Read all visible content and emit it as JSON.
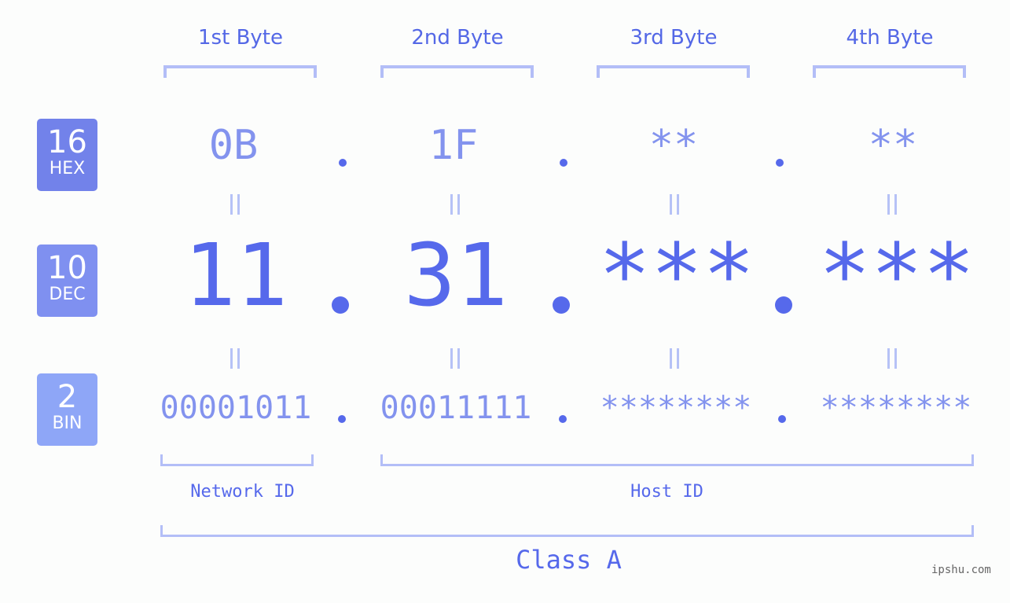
{
  "bytes": [
    {
      "header": "1st Byte",
      "hex": "0B",
      "dec": "11",
      "bin": "00001011"
    },
    {
      "header": "2nd Byte",
      "hex": "1F",
      "dec": "31",
      "bin": "00011111"
    },
    {
      "header": "3rd Byte",
      "hex": "**",
      "dec": "***",
      "bin": "********"
    },
    {
      "header": "4th Byte",
      "hex": "**",
      "dec": "***",
      "bin": "********"
    }
  ],
  "badges": {
    "hex": {
      "num": "16",
      "label": "HEX",
      "color": "#7282ea"
    },
    "dec": {
      "num": "10",
      "label": "DEC",
      "color": "#7f90f0"
    },
    "bin": {
      "num": "2",
      "label": "BIN",
      "color": "#8ea6f7"
    }
  },
  "separator": ".",
  "groups": {
    "network": "Network ID",
    "host": "Host ID",
    "class": "Class A"
  },
  "watermark": "ipshu.com",
  "colors": {
    "primary": "#5669eb",
    "light_text": "#8393ee",
    "bracket": "#b3bef7"
  }
}
